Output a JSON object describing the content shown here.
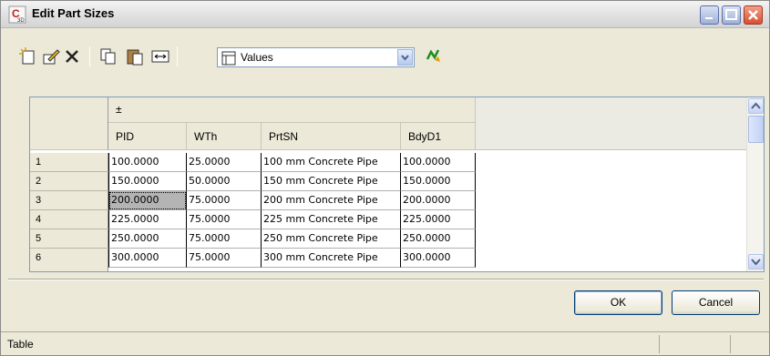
{
  "window": {
    "title": "Edit Part Sizes"
  },
  "toolbar": {
    "combo_value": "Values",
    "icons": [
      "new-row-icon",
      "edit-icon",
      "delete-icon",
      "copy-icon",
      "paste-icon",
      "column-width-icon",
      "table-view-icon",
      "refresh-icon"
    ]
  },
  "grid": {
    "group_header": "±",
    "columns": [
      "PID",
      "WTh",
      "PrtSN",
      "BdyD1"
    ],
    "rows": [
      {
        "num": "1",
        "cells": [
          "100.0000",
          "25.0000",
          "100 mm Concrete Pipe",
          "100.0000"
        ]
      },
      {
        "num": "2",
        "cells": [
          "150.0000",
          "50.0000",
          "150 mm Concrete Pipe",
          "150.0000"
        ]
      },
      {
        "num": "3",
        "cells": [
          "200.0000",
          "75.0000",
          "200 mm Concrete Pipe",
          "200.0000"
        ]
      },
      {
        "num": "4",
        "cells": [
          "225.0000",
          "75.0000",
          "225 mm Concrete Pipe",
          "225.0000"
        ]
      },
      {
        "num": "5",
        "cells": [
          "250.0000",
          "75.0000",
          "250 mm Concrete Pipe",
          "250.0000"
        ]
      },
      {
        "num": "6",
        "cells": [
          "300.0000",
          "75.0000",
          "300 mm Concrete Pipe",
          "300.0000"
        ]
      }
    ]
  },
  "buttons": {
    "ok": "OK",
    "cancel": "Cancel"
  },
  "status": {
    "text": "Table"
  },
  "colors": {
    "selection": "#b4b4b4",
    "close_red": "#d84f2f"
  }
}
